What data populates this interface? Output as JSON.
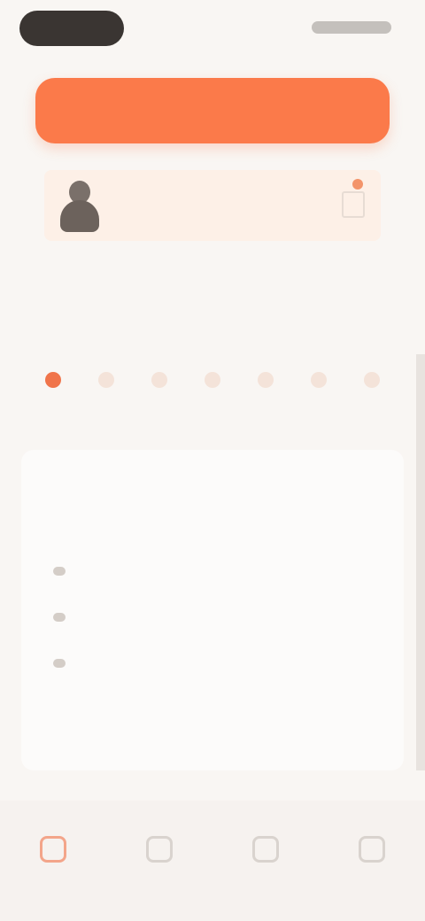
{
  "status_bar": {
    "time": "",
    "indicators": ""
  },
  "banner": {
    "text": ""
  },
  "profile": {
    "name": "",
    "edit_icon": "pencil-icon"
  },
  "schedule": {
    "title": "",
    "link": "",
    "days": [
      "",
      "",
      "",
      "",
      "",
      "",
      ""
    ],
    "active_index": 0
  },
  "info_card": {
    "title": "",
    "description": "",
    "rows": [
      {
        "label": "",
        "value": ""
      },
      {
        "label": "",
        "value": ""
      },
      {
        "label": "",
        "value": ""
      }
    ],
    "view_all": ""
  },
  "bottom_nav": {
    "items": [
      {
        "label": "",
        "icon": "home-icon",
        "active": true
      },
      {
        "label": "",
        "icon": "calendar-icon",
        "active": false
      },
      {
        "label": "",
        "icon": "chat-icon",
        "active": false
      },
      {
        "label": "",
        "icon": "user-icon",
        "active": false
      }
    ]
  },
  "colors": {
    "accent": "#fb7a4a",
    "background": "#f9f6f3",
    "card": "#fdf0e7"
  }
}
